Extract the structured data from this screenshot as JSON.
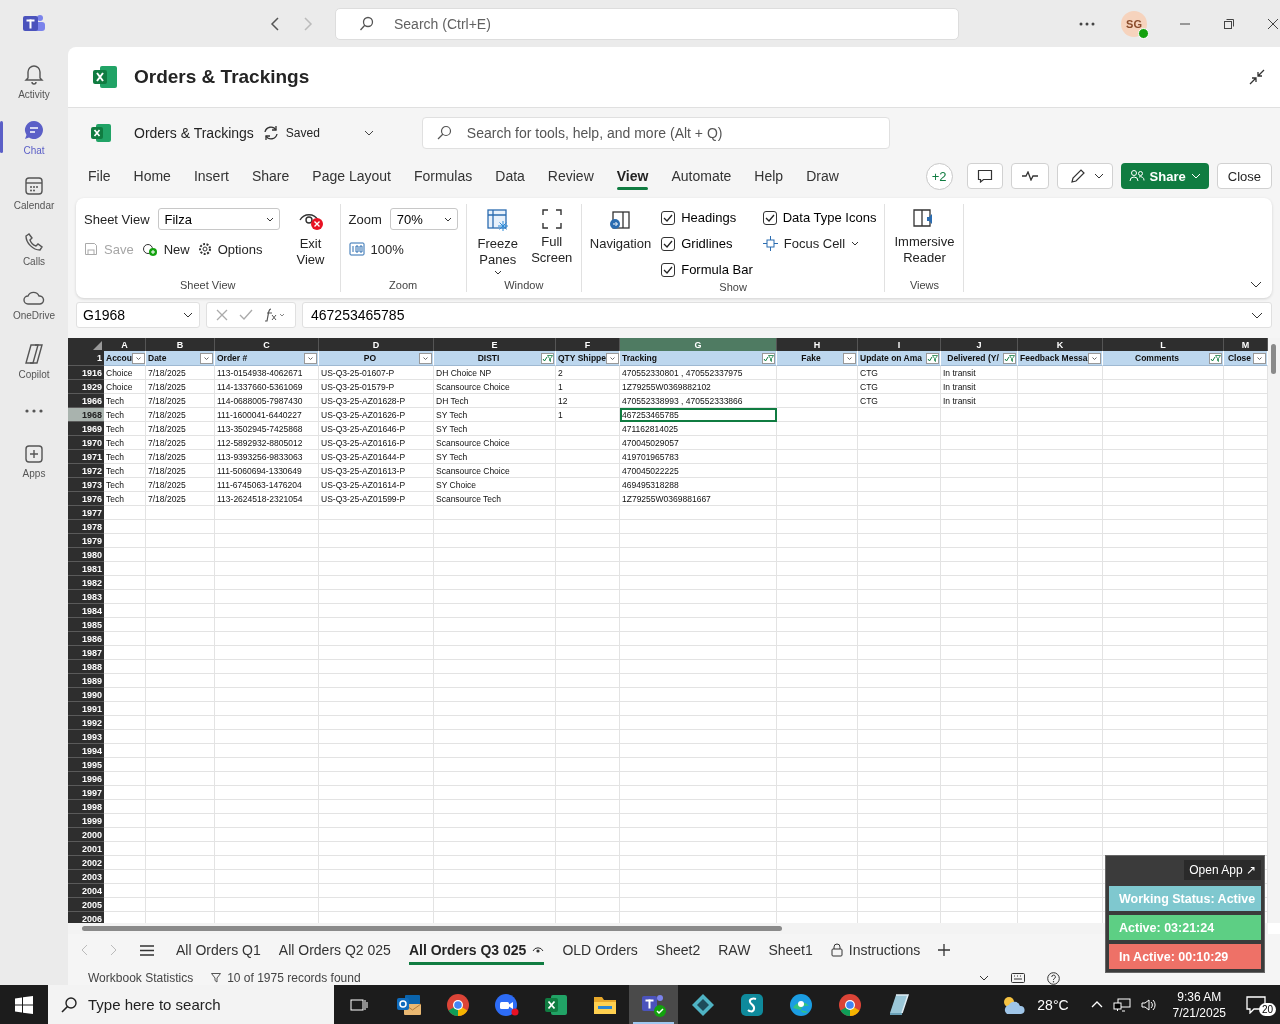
{
  "teams": {
    "search": {
      "placeholder": "Search (Ctrl+E)"
    },
    "avatar": "SG",
    "rail": [
      {
        "kind": "bell",
        "label": "Activity",
        "selected": false
      },
      {
        "kind": "chat",
        "label": "Chat",
        "selected": true
      },
      {
        "kind": "calendar",
        "label": "Calendar",
        "selected": false
      },
      {
        "kind": "phone",
        "label": "Calls",
        "selected": false
      },
      {
        "kind": "cloud",
        "label": "OneDrive",
        "selected": false
      },
      {
        "kind": "copilot",
        "label": "Copilot",
        "selected": false
      },
      {
        "kind": "more",
        "selected": false
      },
      {
        "kind": "plus",
        "label": "Apps",
        "selected": false
      }
    ]
  },
  "app_header": {
    "title": "Orders & Trackings"
  },
  "excel": {
    "file_name": "Orders & Trackings",
    "save_status": "Saved",
    "search": {
      "placeholder": "Search for tools, help, and more (Alt + Q)"
    },
    "menu": [
      {
        "label": "File",
        "selected": false
      },
      {
        "label": "Home",
        "selected": false
      },
      {
        "label": "Insert",
        "selected": false
      },
      {
        "label": "Share",
        "selected": false
      },
      {
        "label": "Page Layout",
        "selected": false
      },
      {
        "label": "Formulas",
        "selected": false
      },
      {
        "label": "Data",
        "selected": false
      },
      {
        "label": "Review",
        "selected": false
      },
      {
        "label": "View",
        "selected": true
      },
      {
        "label": "Automate",
        "selected": false
      },
      {
        "label": "Help",
        "selected": false
      },
      {
        "label": "Draw",
        "selected": false
      }
    ],
    "collaborators": "+2",
    "share": "Share",
    "close": "Close"
  },
  "ribbon": {
    "sheet_view": {
      "label": "Sheet View",
      "field_label": "Sheet View",
      "view_name": "Filza",
      "save": {
        "label": "Save",
        "disabled": true
      },
      "new": "New",
      "options": "Options",
      "exit": "Exit View"
    },
    "zoom": {
      "label": "Zoom",
      "field_label": "Zoom",
      "value": "70%",
      "reset": "100%"
    },
    "window": {
      "label": "Window",
      "freeze": "Freeze Panes",
      "full_screen": "Full Screen"
    },
    "show": {
      "label": "Show",
      "navigation": "Navigation",
      "focus_cell": "Focus Cell",
      "options": [
        {
          "label": "Headings",
          "checked": true
        },
        {
          "label": "Gridlines",
          "checked": true
        },
        {
          "label": "Formula Bar",
          "checked": true
        },
        {
          "label": "Data Type Icons",
          "checked": true
        }
      ]
    },
    "views": {
      "label": "Views",
      "immersive": "Immersive Reader"
    }
  },
  "formula_bar": {
    "name_box": "G1968",
    "formula": "467253465785"
  },
  "sheet": {
    "columns": [
      {
        "letter": "A",
        "heading": "Accou",
        "filtered": false,
        "centered": false,
        "selected": false
      },
      {
        "letter": "B",
        "heading": "Date",
        "filtered": false,
        "centered": false,
        "selected": false
      },
      {
        "letter": "C",
        "heading": "Order #",
        "filtered": false,
        "centered": false,
        "selected": false
      },
      {
        "letter": "D",
        "heading": "PO",
        "filtered": false,
        "centered": true,
        "selected": false
      },
      {
        "letter": "E",
        "heading": "DISTI",
        "filtered": true,
        "centered": true,
        "selected": false
      },
      {
        "letter": "F",
        "heading": "QTY Shippe",
        "filtered": false,
        "centered": false,
        "selected": false
      },
      {
        "letter": "G",
        "heading": "Tracking",
        "filtered": true,
        "centered": false,
        "selected": true
      },
      {
        "letter": "H",
        "heading": "Fake",
        "filtered": false,
        "centered": true,
        "selected": false
      },
      {
        "letter": "I",
        "heading": "Update on Ama",
        "filtered": true,
        "centered": false,
        "selected": false
      },
      {
        "letter": "J",
        "heading": "Delivered (Y/",
        "filtered": true,
        "centered": true,
        "selected": false
      },
      {
        "letter": "K",
        "heading": "Feedback Messa",
        "filtered": false,
        "centered": false,
        "selected": false
      },
      {
        "letter": "L",
        "heading": "Comments",
        "filtered": true,
        "centered": true,
        "selected": false
      },
      {
        "letter": "M",
        "heading": "Close",
        "filtered": false,
        "centered": true,
        "selected": false
      }
    ],
    "header_row": "1",
    "rows": [
      {
        "row": "1916",
        "selected": false,
        "cells": {
          "A": "Choice",
          "B": "7/18/2025",
          "C": "113-0154938-4062671",
          "D": "US-Q3-25-01607-P",
          "E": "DH Choice NP",
          "F": "2",
          "G": "470552330801 , 470552337975",
          "I": "CTG",
          "J": "In transit"
        }
      },
      {
        "row": "1929",
        "selected": false,
        "cells": {
          "A": "Choice",
          "B": "7/18/2025",
          "C": "114-1337660-5361069",
          "D": "US-Q3-25-01579-P",
          "E": "Scansource Choice",
          "F": "1",
          "G": "1Z79255W0369882102",
          "I": "CTG",
          "J": "In transit"
        }
      },
      {
        "row": "1966",
        "selected": false,
        "cells": {
          "A": "Tech",
          "B": "7/18/2025",
          "C": "114-0688005-7987430",
          "D": "US-Q3-25-AZ01628-P",
          "E": "DH Tech",
          "F": "12",
          "G": "470552338993 , 470552333866",
          "I": "CTG",
          "J": "In transit"
        }
      },
      {
        "row": "1968",
        "selected": true,
        "cells": {
          "A": "Tech",
          "B": "7/18/2025",
          "C": "111-1600041-6440227",
          "D": "US-Q3-25-AZ01626-P",
          "E": "SY Tech",
          "F": "1",
          "G": "467253465785"
        }
      },
      {
        "row": "1969",
        "selected": false,
        "cells": {
          "A": "Tech",
          "B": "7/18/2025",
          "C": "113-3502945-7425868",
          "D": "US-Q3-25-AZ01646-P",
          "E": "SY Tech",
          "G": "471162814025"
        }
      },
      {
        "row": "1970",
        "selected": false,
        "cells": {
          "A": "Tech",
          "B": "7/18/2025",
          "C": "112-5892932-8805012",
          "D": "US-Q3-25-AZ01616-P",
          "E": "Scansource Choice",
          "G": "470045029057"
        }
      },
      {
        "row": "1971",
        "selected": false,
        "cells": {
          "A": "Tech",
          "B": "7/18/2025",
          "C": "113-9393256-9833063",
          "D": "US-Q3-25-AZ01644-P",
          "E": "SY Tech",
          "G": "419701965783"
        }
      },
      {
        "row": "1972",
        "selected": false,
        "cells": {
          "A": "Tech",
          "B": "7/18/2025",
          "C": "111-5060694-1330649",
          "D": "US-Q3-25-AZ01613-P",
          "E": "Scansource Choice",
          "G": "470045022225"
        }
      },
      {
        "row": "1973",
        "selected": false,
        "cells": {
          "A": "Tech",
          "B": "7/18/2025",
          "C": "111-6745063-1476204",
          "D": "US-Q3-25-AZ01614-P",
          "E": "SY Choice",
          "G": "469495318288"
        }
      },
      {
        "row": "1976",
        "selected": false,
        "cells": {
          "A": "Tech",
          "B": "7/18/2025",
          "C": "113-2624518-2321054",
          "D": "US-Q3-25-AZ01599-P",
          "E": "Scansource Tech",
          "G": "1Z79255W0369881667"
        }
      },
      {
        "row": "1977",
        "selected": false
      },
      {
        "row": "1978",
        "selected": false
      },
      {
        "row": "1979",
        "selected": false
      },
      {
        "row": "1980",
        "selected": false
      },
      {
        "row": "1981",
        "selected": false
      },
      {
        "row": "1982",
        "selected": false
      },
      {
        "row": "1983",
        "selected": false
      },
      {
        "row": "1984",
        "selected": false
      },
      {
        "row": "1985",
        "selected": false
      },
      {
        "row": "1986",
        "selected": false
      },
      {
        "row": "1987",
        "selected": false
      },
      {
        "row": "1988",
        "selected": false
      },
      {
        "row": "1989",
        "selected": false
      },
      {
        "row": "1990",
        "selected": false
      },
      {
        "row": "1991",
        "selected": false
      },
      {
        "row": "1992",
        "selected": false
      },
      {
        "row": "1993",
        "selected": false
      },
      {
        "row": "1994",
        "selected": false
      },
      {
        "row": "1995",
        "selected": false
      },
      {
        "row": "1996",
        "selected": false
      },
      {
        "row": "1997",
        "selected": false
      },
      {
        "row": "1998",
        "selected": false
      },
      {
        "row": "1999",
        "selected": false
      },
      {
        "row": "2000",
        "selected": false
      },
      {
        "row": "2001",
        "selected": false
      },
      {
        "row": "2002",
        "selected": false
      },
      {
        "row": "2003",
        "selected": false
      },
      {
        "row": "2004",
        "selected": false
      },
      {
        "row": "2005",
        "selected": false
      },
      {
        "row": "2006",
        "selected": false
      }
    ]
  },
  "sheet_tabs": [
    {
      "label": "All Orders Q1",
      "selected": false,
      "locked": false
    },
    {
      "label": "All Orders Q2 025",
      "selected": false,
      "locked": false
    },
    {
      "label": "All Orders Q3 025",
      "selected": true,
      "locked": false
    },
    {
      "label": "OLD Orders",
      "selected": false,
      "locked": false
    },
    {
      "label": "Sheet2",
      "selected": false,
      "locked": false
    },
    {
      "label": "RAW",
      "selected": false,
      "locked": false
    },
    {
      "label": "Sheet1",
      "selected": false,
      "locked": false
    },
    {
      "label": "Instructions",
      "selected": false,
      "locked": true
    }
  ],
  "status_bar": {
    "statistics": "Workbook Statistics",
    "filter_status": "10 of 1975 records found"
  },
  "tracker": {
    "open_app": "Open App ↗",
    "items": [
      {
        "label": "Working Status: Active",
        "color": "#7fc8cf"
      },
      {
        "label": "Active: 03:21:24",
        "color": "#5dcf84"
      },
      {
        "label": "In Active: 00:10:29",
        "color": "#ee7167"
      }
    ]
  },
  "taskbar": {
    "search_placeholder": "Type here to search",
    "apps": [
      {
        "kind": "mail",
        "selected": false
      },
      {
        "kind": "browser",
        "selected": false
      },
      {
        "kind": "video",
        "selected": false
      },
      {
        "kind": "sheet",
        "selected": false
      },
      {
        "kind": "folder",
        "selected": false
      },
      {
        "kind": "chat",
        "selected": true
      },
      {
        "kind": "diamond",
        "selected": false
      },
      {
        "kind": "script",
        "selected": false
      },
      {
        "kind": "wave",
        "selected": false
      },
      {
        "kind": "browser",
        "selected": false
      },
      {
        "kind": "note",
        "selected": false
      }
    ],
    "weather": "28°C",
    "time": "9:36 AM",
    "date": "7/21/2025",
    "notifications": "20"
  }
}
